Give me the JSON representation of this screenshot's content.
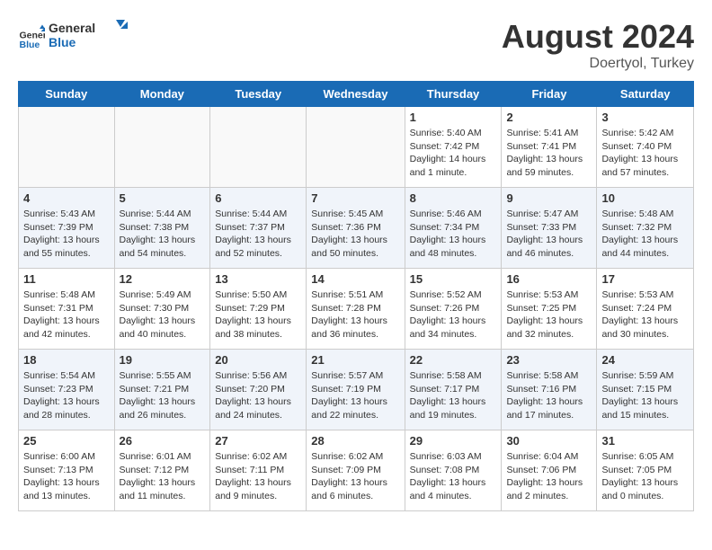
{
  "header": {
    "logo_general": "General",
    "logo_blue": "Blue",
    "month_year": "August 2024",
    "location": "Doertyol, Turkey"
  },
  "weekdays": [
    "Sunday",
    "Monday",
    "Tuesday",
    "Wednesday",
    "Thursday",
    "Friday",
    "Saturday"
  ],
  "weeks": [
    [
      {
        "day": "",
        "info": ""
      },
      {
        "day": "",
        "info": ""
      },
      {
        "day": "",
        "info": ""
      },
      {
        "day": "",
        "info": ""
      },
      {
        "day": "1",
        "info": "Sunrise: 5:40 AM\nSunset: 7:42 PM\nDaylight: 14 hours\nand 1 minute."
      },
      {
        "day": "2",
        "info": "Sunrise: 5:41 AM\nSunset: 7:41 PM\nDaylight: 13 hours\nand 59 minutes."
      },
      {
        "day": "3",
        "info": "Sunrise: 5:42 AM\nSunset: 7:40 PM\nDaylight: 13 hours\nand 57 minutes."
      }
    ],
    [
      {
        "day": "4",
        "info": "Sunrise: 5:43 AM\nSunset: 7:39 PM\nDaylight: 13 hours\nand 55 minutes."
      },
      {
        "day": "5",
        "info": "Sunrise: 5:44 AM\nSunset: 7:38 PM\nDaylight: 13 hours\nand 54 minutes."
      },
      {
        "day": "6",
        "info": "Sunrise: 5:44 AM\nSunset: 7:37 PM\nDaylight: 13 hours\nand 52 minutes."
      },
      {
        "day": "7",
        "info": "Sunrise: 5:45 AM\nSunset: 7:36 PM\nDaylight: 13 hours\nand 50 minutes."
      },
      {
        "day": "8",
        "info": "Sunrise: 5:46 AM\nSunset: 7:34 PM\nDaylight: 13 hours\nand 48 minutes."
      },
      {
        "day": "9",
        "info": "Sunrise: 5:47 AM\nSunset: 7:33 PM\nDaylight: 13 hours\nand 46 minutes."
      },
      {
        "day": "10",
        "info": "Sunrise: 5:48 AM\nSunset: 7:32 PM\nDaylight: 13 hours\nand 44 minutes."
      }
    ],
    [
      {
        "day": "11",
        "info": "Sunrise: 5:48 AM\nSunset: 7:31 PM\nDaylight: 13 hours\nand 42 minutes."
      },
      {
        "day": "12",
        "info": "Sunrise: 5:49 AM\nSunset: 7:30 PM\nDaylight: 13 hours\nand 40 minutes."
      },
      {
        "day": "13",
        "info": "Sunrise: 5:50 AM\nSunset: 7:29 PM\nDaylight: 13 hours\nand 38 minutes."
      },
      {
        "day": "14",
        "info": "Sunrise: 5:51 AM\nSunset: 7:28 PM\nDaylight: 13 hours\nand 36 minutes."
      },
      {
        "day": "15",
        "info": "Sunrise: 5:52 AM\nSunset: 7:26 PM\nDaylight: 13 hours\nand 34 minutes."
      },
      {
        "day": "16",
        "info": "Sunrise: 5:53 AM\nSunset: 7:25 PM\nDaylight: 13 hours\nand 32 minutes."
      },
      {
        "day": "17",
        "info": "Sunrise: 5:53 AM\nSunset: 7:24 PM\nDaylight: 13 hours\nand 30 minutes."
      }
    ],
    [
      {
        "day": "18",
        "info": "Sunrise: 5:54 AM\nSunset: 7:23 PM\nDaylight: 13 hours\nand 28 minutes."
      },
      {
        "day": "19",
        "info": "Sunrise: 5:55 AM\nSunset: 7:21 PM\nDaylight: 13 hours\nand 26 minutes."
      },
      {
        "day": "20",
        "info": "Sunrise: 5:56 AM\nSunset: 7:20 PM\nDaylight: 13 hours\nand 24 minutes."
      },
      {
        "day": "21",
        "info": "Sunrise: 5:57 AM\nSunset: 7:19 PM\nDaylight: 13 hours\nand 22 minutes."
      },
      {
        "day": "22",
        "info": "Sunrise: 5:58 AM\nSunset: 7:17 PM\nDaylight: 13 hours\nand 19 minutes."
      },
      {
        "day": "23",
        "info": "Sunrise: 5:58 AM\nSunset: 7:16 PM\nDaylight: 13 hours\nand 17 minutes."
      },
      {
        "day": "24",
        "info": "Sunrise: 5:59 AM\nSunset: 7:15 PM\nDaylight: 13 hours\nand 15 minutes."
      }
    ],
    [
      {
        "day": "25",
        "info": "Sunrise: 6:00 AM\nSunset: 7:13 PM\nDaylight: 13 hours\nand 13 minutes."
      },
      {
        "day": "26",
        "info": "Sunrise: 6:01 AM\nSunset: 7:12 PM\nDaylight: 13 hours\nand 11 minutes."
      },
      {
        "day": "27",
        "info": "Sunrise: 6:02 AM\nSunset: 7:11 PM\nDaylight: 13 hours\nand 9 minutes."
      },
      {
        "day": "28",
        "info": "Sunrise: 6:02 AM\nSunset: 7:09 PM\nDaylight: 13 hours\nand 6 minutes."
      },
      {
        "day": "29",
        "info": "Sunrise: 6:03 AM\nSunset: 7:08 PM\nDaylight: 13 hours\nand 4 minutes."
      },
      {
        "day": "30",
        "info": "Sunrise: 6:04 AM\nSunset: 7:06 PM\nDaylight: 13 hours\nand 2 minutes."
      },
      {
        "day": "31",
        "info": "Sunrise: 6:05 AM\nSunset: 7:05 PM\nDaylight: 13 hours\nand 0 minutes."
      }
    ]
  ]
}
